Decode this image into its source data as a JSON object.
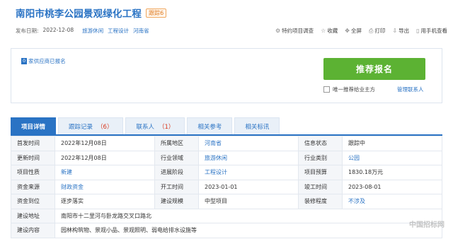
{
  "header": {
    "title": "南阳市桃李公园景观绿化工程",
    "badge": "跟踪6"
  },
  "meta": {
    "publish_label": "发布日期:",
    "publish_date": "2022-12-08",
    "tags": [
      "旅游休闲",
      "工程设计",
      "河南省"
    ]
  },
  "toolbar": {
    "items": [
      {
        "icon": "settings-icon",
        "glyph": "⚙",
        "label": "特约项目调查"
      },
      {
        "icon": "star-icon",
        "glyph": "☆",
        "label": "收藏"
      },
      {
        "icon": "fullscreen-icon",
        "glyph": "✥",
        "label": "全屏"
      },
      {
        "icon": "print-icon",
        "glyph": "⎙",
        "label": "打印"
      },
      {
        "icon": "export-icon",
        "glyph": "⇩",
        "label": "导出"
      },
      {
        "icon": "mobile-icon",
        "glyph": "▯",
        "label": "用手机查看"
      }
    ]
  },
  "panel": {
    "supplier_count": "0",
    "supplier_label": "家供应商已报名",
    "recommend_button": "推荐报名",
    "checkbox_label": "唯一推荐给业主方",
    "contact_link": "管理联系人"
  },
  "tabs": [
    {
      "label": "项目详情",
      "count": ""
    },
    {
      "label": "跟踪记录",
      "count": "（6）"
    },
    {
      "label": "联系人",
      "count": "（1）"
    },
    {
      "label": "相关参考",
      "count": ""
    },
    {
      "label": "相关标讯",
      "count": ""
    }
  ],
  "details": {
    "rows": [
      [
        {
          "k": "首发时间",
          "v": "2022年12月08日",
          "link": false
        },
        {
          "k": "所属地区",
          "v": "河南省",
          "link": true
        },
        {
          "k": "信息状态",
          "v": "跟踪中",
          "link": false
        }
      ],
      [
        {
          "k": "更新时间",
          "v": "2022年12月08日",
          "link": false
        },
        {
          "k": "行业领域",
          "v": "旅游休闲",
          "link": true
        },
        {
          "k": "行业类别",
          "v": "公园",
          "link": true
        }
      ],
      [
        {
          "k": "项目性质",
          "v": "新建",
          "link": true
        },
        {
          "k": "进展阶段",
          "v": "工程设计",
          "link": true
        },
        {
          "k": "项目预算",
          "v": "1830.18万元",
          "link": false
        }
      ],
      [
        {
          "k": "资金来源",
          "v": "财政资金",
          "link": true
        },
        {
          "k": "开工时间",
          "v": "2023-01-01",
          "link": false
        },
        {
          "k": "竣工时间",
          "v": "2023-08-01",
          "link": false
        }
      ],
      [
        {
          "k": "资金到位",
          "v": "逐步落实",
          "link": false
        },
        {
          "k": "建设规模",
          "v": "中型项目",
          "link": false
        },
        {
          "k": "装修程度",
          "v": "不涉及",
          "link": true
        }
      ]
    ],
    "address_label": "建设地址",
    "address": "南阳市十二里河与卧龙路交叉口路北",
    "content_label": "建设内容",
    "content": "园林构筑物、景观小品、景观照明、弱电给排水设施等"
  },
  "watermark": "中国招标网"
}
